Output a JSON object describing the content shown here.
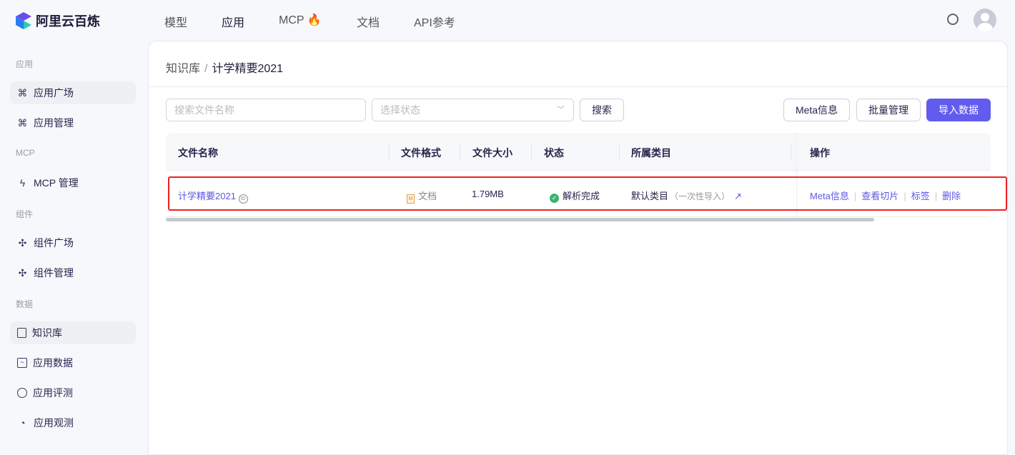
{
  "app": {
    "title": "阿里云百炼"
  },
  "nav": [
    {
      "label": "模型"
    },
    {
      "label": "应用"
    },
    {
      "label": "MCP"
    },
    {
      "label": "文档"
    },
    {
      "label": "API参考"
    }
  ],
  "sidebar": {
    "sections": [
      {
        "label": "应用"
      },
      {
        "label": "MCP"
      },
      {
        "label": "组件"
      },
      {
        "label": "数据"
      }
    ],
    "items": [
      {
        "label": "应用广场"
      },
      {
        "label": "应用管理"
      },
      {
        "label": "MCP 管理"
      },
      {
        "label": "组件广场"
      },
      {
        "label": "组件管理"
      },
      {
        "label": "知识库"
      },
      {
        "label": "应用数据"
      },
      {
        "label": "应用评测"
      },
      {
        "label": "应用观测"
      }
    ]
  },
  "breadcrumb": {
    "parent": "知识库",
    "sep": "/",
    "current": "计学精要2021"
  },
  "toolbar": {
    "search_placeholder": "搜索文件名称",
    "status_placeholder": "选择状态",
    "search": "搜索",
    "meta": "Meta信息",
    "batch": "批量管理",
    "import": "导入数据"
  },
  "table": {
    "columns": [
      "文件名称",
      "文件格式",
      "文件大小",
      "状态",
      "所属类目",
      "操作"
    ],
    "rows": [
      {
        "name": "计学精要2021",
        "format": "文档",
        "size": "1.79MB",
        "status": "解析完成",
        "category": "默认类目",
        "category_note": "（一次性导入）",
        "ops": [
          "Meta信息",
          "查看切片",
          "标签",
          "删除"
        ]
      }
    ]
  },
  "colors": {
    "accent": "#615ced",
    "highlight": "#f01f1f",
    "success": "#3cb371"
  }
}
